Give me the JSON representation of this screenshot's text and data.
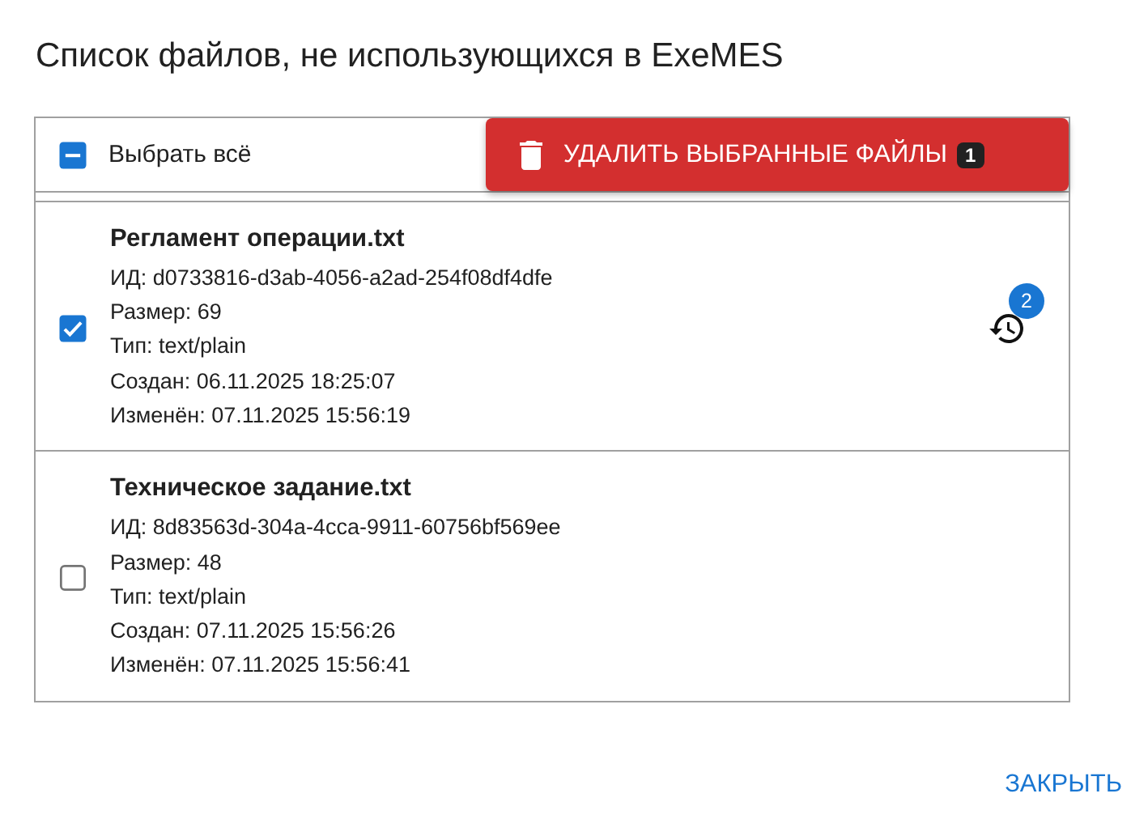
{
  "title": "Список файлов, не использующихся в ExeMES",
  "select_all": {
    "label": "Выбрать всё",
    "indeterminate": true
  },
  "delete_button": {
    "label": "УДАЛИТЬ ВЫБРАННЫЕ ФАЙЛЫ",
    "badge": "1"
  },
  "files": [
    {
      "name": "Регламент операции.txt",
      "checked": true,
      "lines": [
        "ИД: d0733816-d3ab-4056-a2ad-254f08df4dfe",
        "Размер: 69",
        "Тип: text/plain",
        "Создан: 06.11.2025 18:25:07",
        "Изменён: 07.11.2025 15:56:19"
      ],
      "history_badge": "2"
    },
    {
      "name": "Техническое задание.txt",
      "checked": false,
      "lines": [
        "ИД: 8d83563d-304a-4cca-9911-60756bf569ee",
        "Размер: 48",
        "Тип: text/plain",
        "Создан: 07.11.2025 15:56:26",
        "Изменён: 07.11.2025 15:56:41"
      ]
    }
  ],
  "close_button": "ЗАКРЫТЬ"
}
